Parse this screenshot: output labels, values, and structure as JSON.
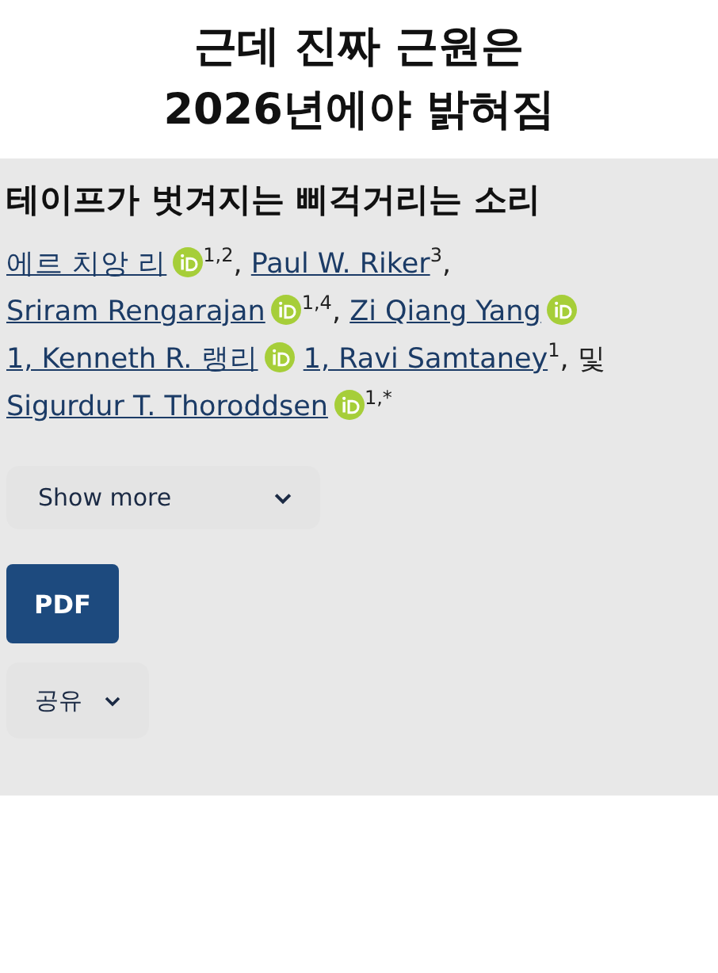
{
  "caption": {
    "lines": [
      "근데 진짜 근원은",
      "2026년에야 밝혀짐"
    ]
  },
  "article": {
    "title": "테이프가 벗겨지는 삐걱거리는 소리",
    "authors": [
      {
        "name": "에르 치앙 리",
        "orcid": true,
        "sup": "1,2",
        "sep": ","
      },
      {
        "name": "Paul W. Riker",
        "orcid": false,
        "sup": "3",
        "sep": ","
      },
      {
        "name": "Sriram Rengarajan",
        "orcid": true,
        "sup": "1,4",
        "sep": ","
      },
      {
        "name": "Zi Qiang Yang",
        "orcid": true
      },
      {
        "name": "1, Kenneth R. 랭리",
        "orcid": true
      },
      {
        "name": "1, Ravi Samtaney",
        "orcid": false,
        "sup": "1",
        "sep": ", 및"
      },
      {
        "name": "Sigurdur T. Thoroddsen",
        "orcid": true,
        "sup": "1,*"
      }
    ],
    "show_more": {
      "label": "Show more",
      "expanded": false
    },
    "pdf_button": "PDF",
    "share": {
      "label": "공유",
      "expanded": false
    }
  }
}
